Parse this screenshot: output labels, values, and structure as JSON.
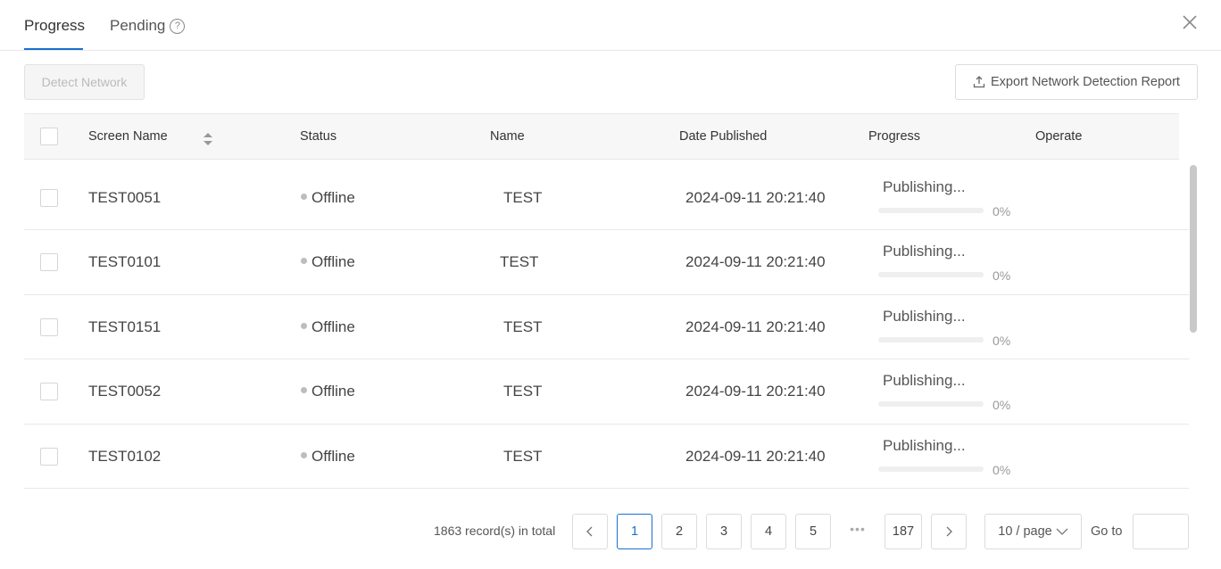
{
  "tabs": {
    "progress": "Progress",
    "pending": "Pending",
    "help_glyph": "?"
  },
  "toolbar": {
    "detect_label": "Detect Network",
    "export_label": "Export Network Detection Report"
  },
  "table": {
    "columns": {
      "screen_name": "Screen Name",
      "status": "Status",
      "name": "Name",
      "date_published": "Date Published",
      "progress": "Progress",
      "operate": "Operate"
    },
    "rows": [
      {
        "screen_name": "TEST0051",
        "status": "Offline",
        "name": "TEST",
        "date": "2024-09-11 20:21:40",
        "progress_label": "Publishing...",
        "percent_text": "0%",
        "percent": 0
      },
      {
        "screen_name": "TEST0101",
        "status": "Offline",
        "name": "TEST",
        "date": "2024-09-11 20:21:40",
        "progress_label": "Publishing...",
        "percent_text": "0%",
        "percent": 0
      },
      {
        "screen_name": "TEST0151",
        "status": "Offline",
        "name": "TEST",
        "date": "2024-09-11 20:21:40",
        "progress_label": "Publishing...",
        "percent_text": "0%",
        "percent": 0
      },
      {
        "screen_name": "TEST0052",
        "status": "Offline",
        "name": "TEST",
        "date": "2024-09-11 20:21:40",
        "progress_label": "Publishing...",
        "percent_text": "0%",
        "percent": 0
      },
      {
        "screen_name": "TEST0102",
        "status": "Offline",
        "name": "TEST",
        "date": "2024-09-11 20:21:40",
        "progress_label": "Publishing...",
        "percent_text": "0%",
        "percent": 0
      }
    ]
  },
  "pagination": {
    "total_text": "1863 record(s) in total",
    "pages": [
      "1",
      "2",
      "3",
      "4",
      "5"
    ],
    "ellipsis": "•••",
    "last_page": "187",
    "current_page": "1",
    "page_size": "10 / page",
    "goto_label": "Go to",
    "goto_value": ""
  },
  "colors": {
    "accent": "#1a6fd1",
    "status_offline": "#bdbdbd"
  },
  "icons": {
    "close": "close-icon",
    "help": "question-circle-icon",
    "export": "upload-icon",
    "sort": "sort-icon",
    "prev": "chevron-left-icon",
    "next": "chevron-right-icon",
    "dropdown": "chevron-down-icon"
  }
}
